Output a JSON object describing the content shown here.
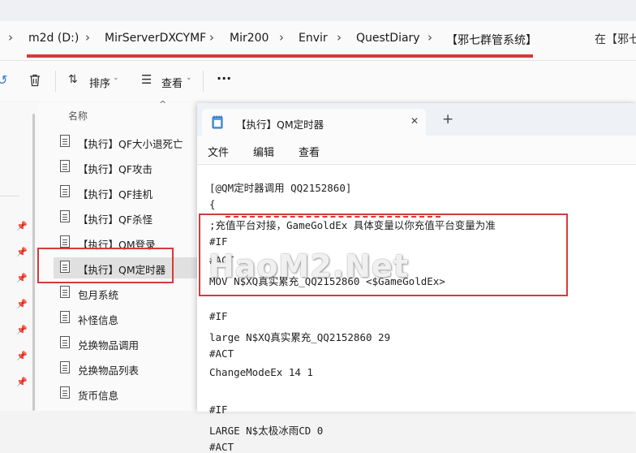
{
  "breadcrumb": {
    "items": [
      "m2d (D:)",
      "MirServerDXCYMF",
      "Mir200",
      "Envir",
      "QuestDiary",
      "【邪七群管系统】"
    ],
    "search_hint": "在【邪七"
  },
  "toolbar": {
    "sort_label": "排序",
    "view_label": "查看",
    "more_label": "···"
  },
  "file_list": {
    "header": "名称",
    "items": [
      "【执行】QF大小退死亡",
      "【执行】QF攻击",
      "【执行】QF挂机",
      "【执行】QF杀怪",
      "【执行】QM登录",
      "【执行】QM定时器",
      "包月系统",
      "补怪信息",
      "兑换物品调用",
      "兑换物品列表",
      "货币信息"
    ],
    "selected_index": 5
  },
  "notepad": {
    "tab_title": "【执行】QM定时器",
    "close_glyph": "✕",
    "new_tab_glyph": "+",
    "menu": [
      "文件",
      "编辑",
      "查看"
    ],
    "lines": [
      "[@QM定时器调用 QQ2152860]",
      "{",
      ";充值平台对接，GameGoldEx 具体变量以你充值平台变量为准",
      "#IF",
      "#ACT",
      "MOV N$XQ真实累充_QQ2152860 <$GameGoldEx>",
      "",
      "#IF",
      "large N$XQ真实累充_QQ2152860 29",
      "#ACT",
      "ChangeModeEx 14 1",
      "",
      "#IF",
      "LARGE N$太极冰雨CD 0",
      "#ACT"
    ]
  },
  "watermark": "HaoM2.Net",
  "colors": {
    "highlight_red": "#d63a3a"
  }
}
